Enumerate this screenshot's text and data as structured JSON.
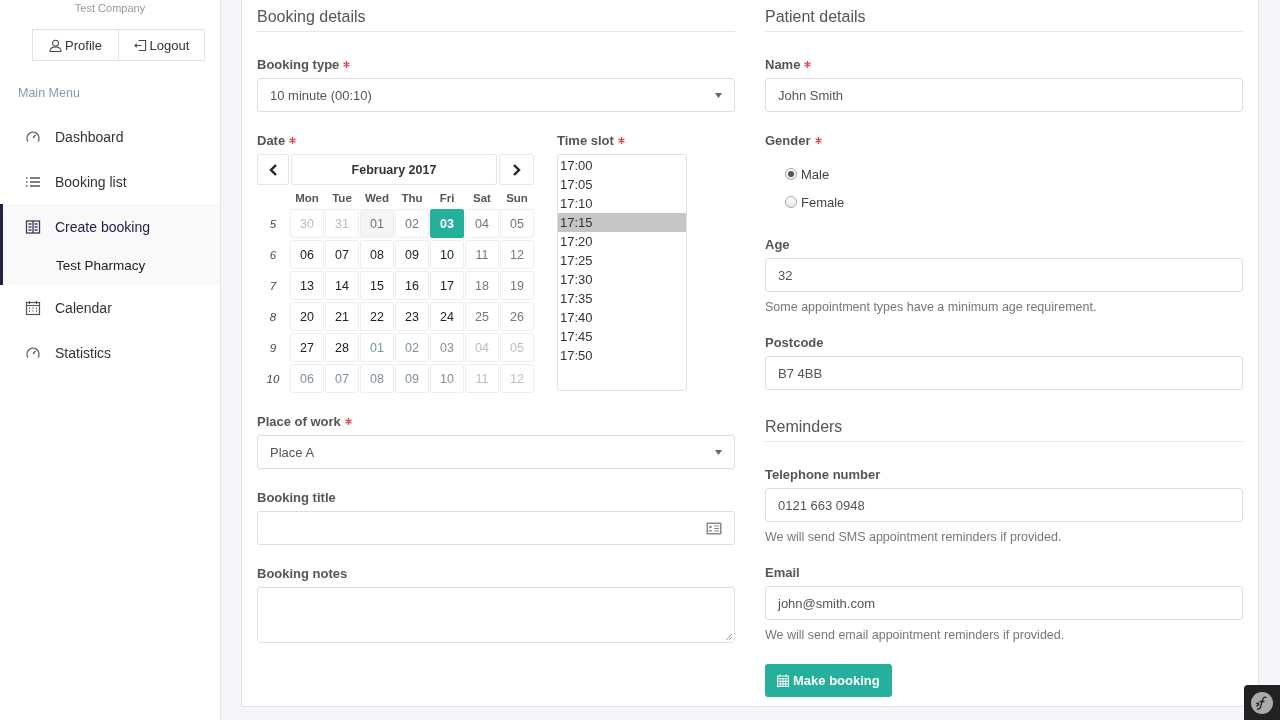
{
  "sidebar": {
    "company": "Test Company",
    "buttons": [
      {
        "label": "Profile",
        "kind": "user"
      },
      {
        "label": "Logout",
        "kind": "logout"
      }
    ],
    "menu_title": "Main Menu",
    "items": [
      {
        "label": "Dashboard",
        "kind": "gauge",
        "selected": false
      },
      {
        "label": "Booking list",
        "kind": "list",
        "selected": false
      },
      {
        "label": "Create booking",
        "kind": "book",
        "selected": true,
        "children": [
          {
            "label": "Test Pharmacy"
          }
        ]
      },
      {
        "label": "Calendar",
        "kind": "calendar",
        "selected": false
      },
      {
        "label": "Statistics",
        "kind": "gauge",
        "selected": false
      }
    ]
  },
  "booking": {
    "heading": "Booking details",
    "booking_type": {
      "label": "Booking type",
      "required": true,
      "value": "10 minute (00:10)"
    },
    "date": {
      "label": "Date",
      "required": true,
      "month": "February 2017",
      "weekdays": [
        "Mon",
        "Tue",
        "Wed",
        "Thu",
        "Fri",
        "Sat",
        "Sun"
      ],
      "weeks": [
        {
          "number": "5",
          "days": [
            {
              "label": "30",
              "kind": "adjacent-closed",
              "selected": false
            },
            {
              "label": "31",
              "kind": "adjacent-closed",
              "selected": false
            },
            {
              "label": "01",
              "kind": "today",
              "selected": false
            },
            {
              "label": "02",
              "kind": "closed",
              "selected": false
            },
            {
              "label": "03",
              "kind": "open",
              "selected": true
            },
            {
              "label": "04",
              "kind": "closed",
              "selected": false
            },
            {
              "label": "05",
              "kind": "closed",
              "selected": false
            }
          ]
        },
        {
          "number": "6",
          "days": [
            {
              "label": "06",
              "kind": "open",
              "selected": false
            },
            {
              "label": "07",
              "kind": "open",
              "selected": false
            },
            {
              "label": "08",
              "kind": "open",
              "selected": false
            },
            {
              "label": "09",
              "kind": "open",
              "selected": false
            },
            {
              "label": "10",
              "kind": "open",
              "selected": false
            },
            {
              "label": "11",
              "kind": "closed",
              "selected": false
            },
            {
              "label": "12",
              "kind": "closed",
              "selected": false
            }
          ]
        },
        {
          "number": "7",
          "days": [
            {
              "label": "13",
              "kind": "open",
              "selected": false
            },
            {
              "label": "14",
              "kind": "open",
              "selected": false
            },
            {
              "label": "15",
              "kind": "open",
              "selected": false
            },
            {
              "label": "16",
              "kind": "open",
              "selected": false
            },
            {
              "label": "17",
              "kind": "open",
              "selected": false
            },
            {
              "label": "18",
              "kind": "closed",
              "selected": false
            },
            {
              "label": "19",
              "kind": "closed",
              "selected": false
            }
          ]
        },
        {
          "number": "8",
          "days": [
            {
              "label": "20",
              "kind": "open",
              "selected": false
            },
            {
              "label": "21",
              "kind": "open",
              "selected": false
            },
            {
              "label": "22",
              "kind": "open",
              "selected": false
            },
            {
              "label": "23",
              "kind": "open",
              "selected": false
            },
            {
              "label": "24",
              "kind": "open",
              "selected": false
            },
            {
              "label": "25",
              "kind": "closed",
              "selected": false
            },
            {
              "label": "26",
              "kind": "closed",
              "selected": false
            }
          ]
        },
        {
          "number": "9",
          "days": [
            {
              "label": "27",
              "kind": "open",
              "selected": false
            },
            {
              "label": "28",
              "kind": "open",
              "selected": false
            },
            {
              "label": "01",
              "kind": "adjacent",
              "selected": false
            },
            {
              "label": "02",
              "kind": "adjacent",
              "selected": false
            },
            {
              "label": "03",
              "kind": "adjacent",
              "selected": false
            },
            {
              "label": "04",
              "kind": "adjacent-closed",
              "selected": false
            },
            {
              "label": "05",
              "kind": "adjacent-closed",
              "selected": false
            }
          ]
        },
        {
          "number": "10",
          "days": [
            {
              "label": "06",
              "kind": "adjacent",
              "selected": false
            },
            {
              "label": "07",
              "kind": "adjacent",
              "selected": false
            },
            {
              "label": "08",
              "kind": "adjacent",
              "selected": false
            },
            {
              "label": "09",
              "kind": "adjacent",
              "selected": false
            },
            {
              "label": "10",
              "kind": "adjacent",
              "selected": false
            },
            {
              "label": "11",
              "kind": "adjacent-closed",
              "selected": false
            },
            {
              "label": "12",
              "kind": "adjacent-closed",
              "selected": false
            }
          ]
        }
      ]
    },
    "time_slot": {
      "label": "Time slot",
      "required": true,
      "options": [
        {
          "label": "17:00",
          "selected": false
        },
        {
          "label": "17:05",
          "selected": false
        },
        {
          "label": "17:10",
          "selected": false
        },
        {
          "label": "17:15",
          "selected": true
        },
        {
          "label": "17:20",
          "selected": false
        },
        {
          "label": "17:25",
          "selected": false
        },
        {
          "label": "17:30",
          "selected": false
        },
        {
          "label": "17:35",
          "selected": false
        },
        {
          "label": "17:40",
          "selected": false
        },
        {
          "label": "17:45",
          "selected": false
        },
        {
          "label": "17:50",
          "selected": false
        }
      ]
    },
    "place_of_work": {
      "label": "Place of work",
      "required": true,
      "value": "Place A"
    },
    "booking_title": {
      "label": "Booking title"
    },
    "booking_notes": {
      "label": "Booking notes"
    }
  },
  "patient": {
    "heading": "Patient details",
    "name": {
      "label": "Name",
      "required": true,
      "value": "John Smith"
    },
    "gender": {
      "label": "Gender",
      "required": true,
      "options": [
        {
          "label": "Male",
          "selected": true
        },
        {
          "label": "Female",
          "selected": false
        }
      ]
    },
    "age": {
      "label": "Age",
      "value": "32",
      "help": "Some appointment types have a minimum age requirement."
    },
    "postcode": {
      "label": "Postcode",
      "value": "B7 4BB"
    }
  },
  "reminders": {
    "heading": "Reminders",
    "telephone": {
      "label": "Telephone number",
      "value": "0121 663 0948",
      "help": "We will send SMS appointment reminders if provided."
    },
    "email": {
      "label": "Email",
      "value": "john@smith.com",
      "help": "We will send email appointment reminders if provided."
    }
  },
  "submit": {
    "label": "Make booking"
  }
}
